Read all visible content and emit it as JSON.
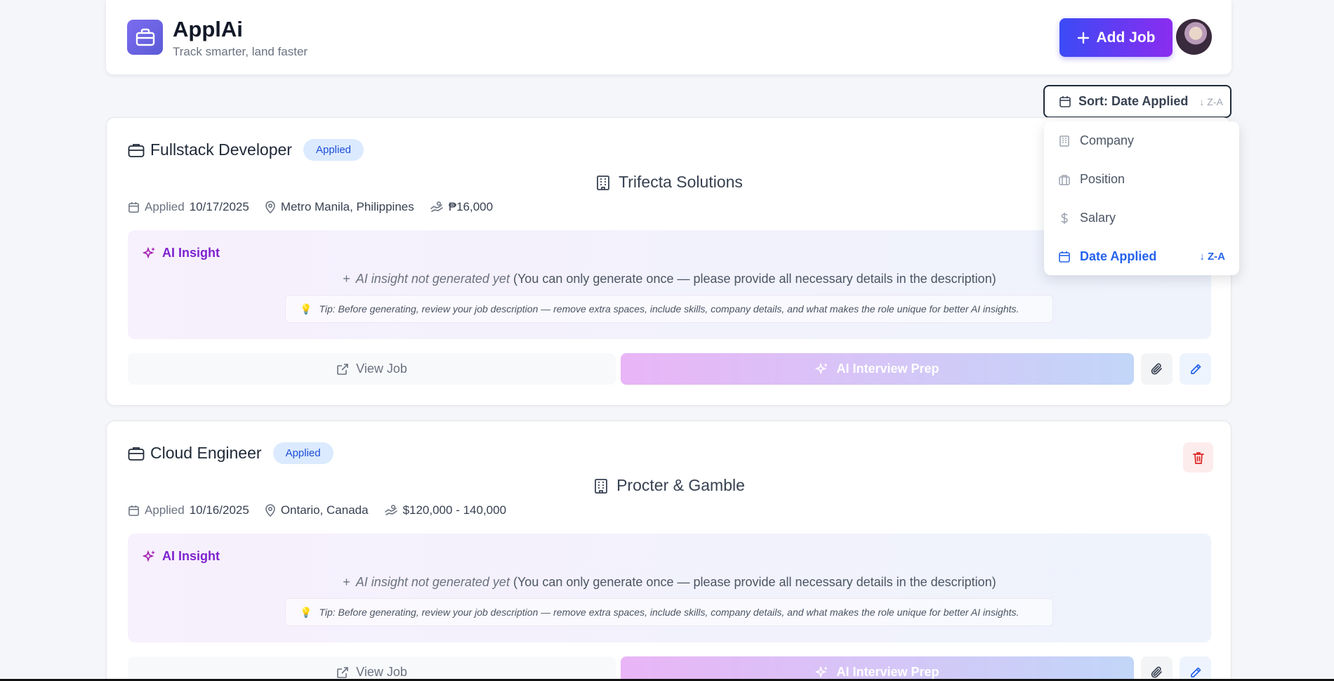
{
  "header": {
    "app_title": "ApplAi",
    "app_subtitle": "Track smarter, land faster",
    "add_job_label": "Add Job",
    "logo_icon": "briefcase-icon"
  },
  "sort": {
    "label": "Sort: Date Applied",
    "direction": "↓ Z-A",
    "options": [
      {
        "label": "Company",
        "icon": "building-icon"
      },
      {
        "label": "Position",
        "icon": "briefcase-icon"
      },
      {
        "label": "Salary",
        "icon": "dollar-icon"
      },
      {
        "label": "Date Applied",
        "icon": "calendar-icon",
        "active": true,
        "direction": "↓ Z-A"
      }
    ]
  },
  "jobs": [
    {
      "title": "Fullstack Developer",
      "status": "Applied",
      "company": "Trifecta Solutions",
      "applied_label": "Applied",
      "applied_date": "10/17/2025",
      "location": "Metro Manila, Philippines",
      "salary": "₱16,000",
      "insight_title": "AI Insight",
      "insight_empty": "AI insight not generated yet",
      "insight_note": " (You can only generate once — please provide all necessary details in the description)",
      "tip": "Tip: Before generating, review your job description — remove extra spaces, include skills, company details, and what makes the role unique for better AI insights.",
      "view_label": "View Job",
      "prep_label": "AI Interview Prep"
    },
    {
      "title": "Cloud Engineer",
      "status": "Applied",
      "company": "Procter & Gamble",
      "applied_label": "Applied",
      "applied_date": "10/16/2025",
      "location": "Ontario, Canada",
      "salary": "$120,000 - 140,000",
      "insight_title": "AI Insight",
      "insight_empty": "AI insight not generated yet",
      "insight_note": " (You can only generate once — please provide all necessary details in the description)",
      "tip": "Tip: Before generating, review your job description — remove extra spaces, include skills, company details, and what makes the role unique for better AI insights.",
      "view_label": "View Job",
      "prep_label": "AI Interview Prep"
    }
  ],
  "colors": {
    "accent_blue": "#2563eb",
    "insight_purple": "#7e22ce",
    "badge_bg": "#dbeafe",
    "delete_red": "#dc2626"
  }
}
